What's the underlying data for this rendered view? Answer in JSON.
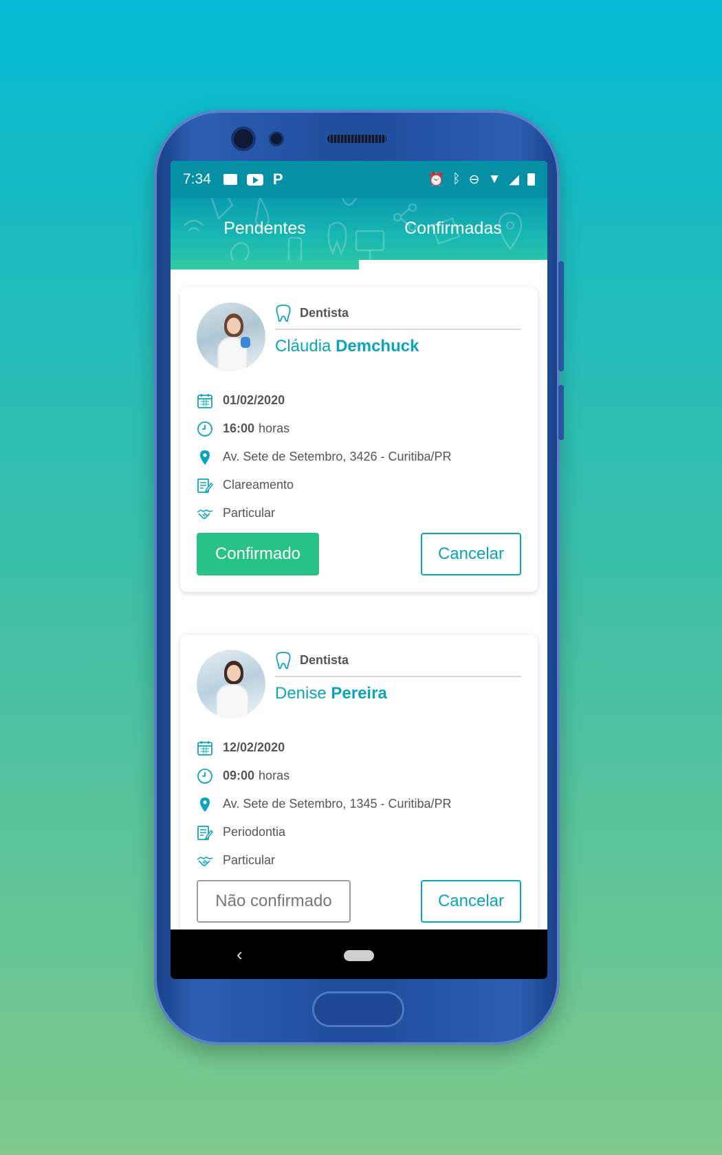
{
  "status_bar": {
    "time": "7:34",
    "left_icons": [
      "image-icon",
      "youtube-icon",
      "p-icon"
    ],
    "right_icons": [
      "alarm-icon",
      "bluetooth-icon",
      "dnd-icon",
      "wifi-icon",
      "signal-icon",
      "battery-icon"
    ]
  },
  "tabs": [
    {
      "label": "Pendentes",
      "active": true
    },
    {
      "label": "Confirmadas",
      "active": false
    }
  ],
  "appointments": [
    {
      "specialty": "Dentista",
      "first_name": "Cláudia",
      "last_name": "Demchuck",
      "date": "01/02/2020",
      "time": "16:00",
      "time_suffix": "horas",
      "address": "Av. Sete de Setembro, 3426 - Curitiba/PR",
      "procedure": "Clareamento",
      "payment": "Particular",
      "status_label": "Confirmado",
      "cancel_label": "Cancelar"
    },
    {
      "specialty": "Dentista",
      "first_name": "Denise",
      "last_name": "Pereira",
      "date": "12/02/2020",
      "time": "09:00",
      "time_suffix": "horas",
      "address": "Av. Sete de Setembro, 1345 - Curitiba/PR",
      "procedure": "Periodontia",
      "payment": "Particular",
      "status_label": "Não confirmado",
      "cancel_label": "Cancelar"
    }
  ],
  "colors": {
    "accent": "#0aa5bd",
    "confirmed": "#27c285",
    "tab_gradient_start": "#0a9bb0",
    "tab_gradient_end": "#2fc9a5"
  }
}
